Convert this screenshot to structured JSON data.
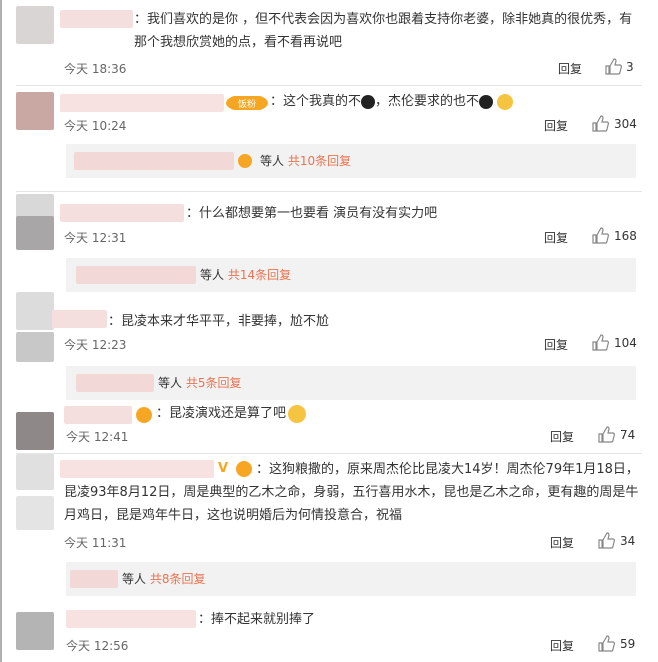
{
  "comments": [
    {
      "text": "：我们喜欢的是你 ，但不代表会因为喜欢你也跟着支持你老婆，除非她真的很优秀，有那个我想欣赏她的点，看不看再说吧",
      "time": "今天 18:36",
      "reply": "回复",
      "likes": "3"
    },
    {
      "text": "：这个我真的不",
      "text2": "，杰伦要求的也不",
      "time": "今天 10:24",
      "reply": "回复",
      "likes": "304",
      "sub_suffix": "等人",
      "sub_count": "共10条回复"
    },
    {
      "text": "：什么都想要第一也要看 演员有没有实力吧",
      "time": "今天 12:31",
      "reply": "回复",
      "likes": "168",
      "sub_suffix": "等人",
      "sub_count": "共14条回复"
    },
    {
      "text": "：昆凌本来才华平平，非要捧，尬不尬",
      "time": "今天 12:23",
      "reply": "回复",
      "likes": "104",
      "sub_suffix": "等人",
      "sub_count": "共5条回复"
    },
    {
      "text": "：昆凌演戏还是算了吧",
      "time": "今天 12:41",
      "reply": "回复",
      "likes": "74"
    },
    {
      "text": "：这狗粮撒的，原来周杰伦比昆凌大14岁！周杰伦79年1月18日，昆凌93年8月12日，周是典型的乙木之命，身弱，五行喜用水木，昆也是乙木之命，更有趣的周是牛月鸡日，昆是鸡年牛日，这也说明婚后为何情投意合，祝福",
      "time": "今天 11:31",
      "reply": "回复",
      "likes": "34",
      "sub_suffix": "等人",
      "sub_count": "共8条回复"
    },
    {
      "text": "：捧不起来就别捧了",
      "time": "今天 12:56",
      "reply": "回复",
      "likes": "59"
    }
  ],
  "colors": {
    "link": "#eb7350",
    "text": "#333333",
    "meta": "#666666",
    "subbar": "#f2f2f2",
    "separator": "#e5e5e5"
  },
  "icons": {
    "like": "thumb-up-icon",
    "vip": "crown-badge-icon",
    "verified": "v-verified-icon",
    "emoji": "laugh-emoji-icon"
  }
}
